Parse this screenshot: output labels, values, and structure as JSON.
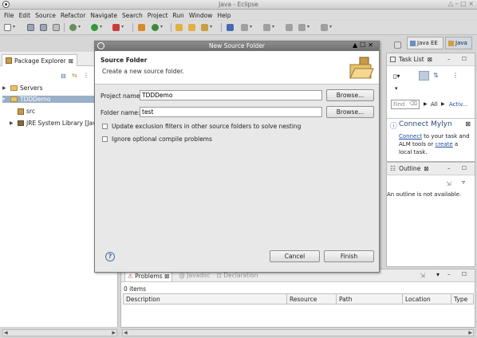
{
  "window": {
    "title": "Java - Eclipse",
    "controls": "△ – □ ×"
  },
  "menubar": {
    "items": [
      "File",
      "Edit",
      "Source",
      "Refactor",
      "Navigate",
      "Search",
      "Project",
      "Run",
      "Window",
      "Help"
    ]
  },
  "package_explorer": {
    "tab_label": "Package Explorer",
    "tree": [
      {
        "label": "Servers",
        "expanded": false
      },
      {
        "label": "TDDDemo",
        "expanded": true,
        "selected": true
      },
      {
        "label": "src"
      },
      {
        "label": "JRE System Library [Java"
      }
    ]
  },
  "perspectives": {
    "java_ee": "Java EE",
    "java": "Java"
  },
  "task_list": {
    "tab_label": "Task List",
    "find_placeholder": "Find",
    "all_label": "All",
    "activate_label": "Activ..."
  },
  "mylyn": {
    "title": "Connect Mylyn",
    "text_connect": "Connect",
    "text_middle": " to your task and ALM tools or ",
    "text_create": "create",
    "text_end": " a local task."
  },
  "outline": {
    "tab_label": "Outline",
    "message": "An outline is not available."
  },
  "problems_panel": {
    "tabs": [
      "Problems",
      "Javadoc",
      "Declaration"
    ],
    "count": "0 items",
    "columns": [
      "Description",
      "Resource",
      "Path",
      "Location",
      "Type"
    ]
  },
  "dialog": {
    "window_title": "New Source Folder",
    "header_title": "Source Folder",
    "header_desc": "Create a new source folder.",
    "project_label": "Project name:",
    "project_value": "TDDDemo",
    "folder_label": "Folder name:",
    "folder_value": "test",
    "browse1": "Browse...",
    "browse2": "Browse...",
    "check1_label": "Update exclusion filters in other source folders to solve nesting",
    "check2_label": "Ignore optional compile problems",
    "cancel": "Cancel",
    "finish": "Finish",
    "help": "?"
  }
}
